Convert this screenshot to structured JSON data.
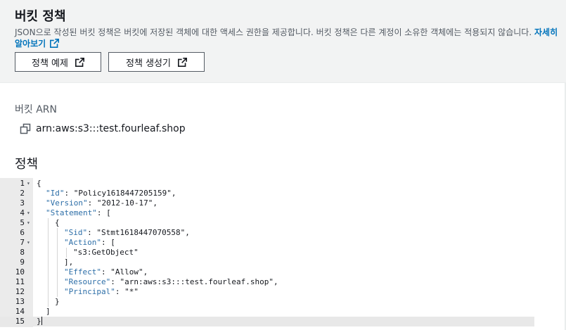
{
  "header": {
    "title": "버킷 정책",
    "description": "JSON으로 작성된 버킷 정책은 버킷에 저장된 객체에 대한 액세스 권한을 제공합니다. 버킷 정책은 다른 계정이 소유한 객체에는 적용되지 않습니다.",
    "learn_more": "자세히 알아보기",
    "btn_examples": "정책 예제",
    "btn_generator": "정책 생성기"
  },
  "arn": {
    "label": "버킷 ARN",
    "value": "arn:aws:s3:::test.fourleaf.shop",
    "copy_icon": "copy-icon"
  },
  "policy": {
    "label": "정책",
    "lines": [
      {
        "n": "1",
        "fold": true,
        "indent": 0,
        "text": "{"
      },
      {
        "n": "2",
        "indent": 1,
        "key": "\"Id\"",
        "val": "\"Policy1618447205159\","
      },
      {
        "n": "3",
        "indent": 1,
        "key": "\"Version\"",
        "val": "\"2012-10-17\","
      },
      {
        "n": "4",
        "fold": true,
        "indent": 1,
        "key": "\"Statement\"",
        "val": "["
      },
      {
        "n": "5",
        "fold": true,
        "indent": 2,
        "text": "{"
      },
      {
        "n": "6",
        "indent": 3,
        "key": "\"Sid\"",
        "val": "\"Stmt1618447070558\","
      },
      {
        "n": "7",
        "fold": true,
        "indent": 3,
        "key": "\"Action\"",
        "val": "["
      },
      {
        "n": "8",
        "indent": 4,
        "text": "\"s3:GetObject\""
      },
      {
        "n": "9",
        "indent": 3,
        "text": "],"
      },
      {
        "n": "10",
        "indent": 3,
        "key": "\"Effect\"",
        "val": "\"Allow\","
      },
      {
        "n": "11",
        "indent": 3,
        "key": "\"Resource\"",
        "val": "\"arn:aws:s3:::test.fourleaf.shop\","
      },
      {
        "n": "12",
        "indent": 3,
        "key": "\"Principal\"",
        "val": "\"*\""
      },
      {
        "n": "13",
        "indent": 2,
        "text": "}"
      },
      {
        "n": "14",
        "indent": 1,
        "text": "]"
      },
      {
        "n": "15",
        "indent": 0,
        "text": "}",
        "active": true
      }
    ]
  }
}
